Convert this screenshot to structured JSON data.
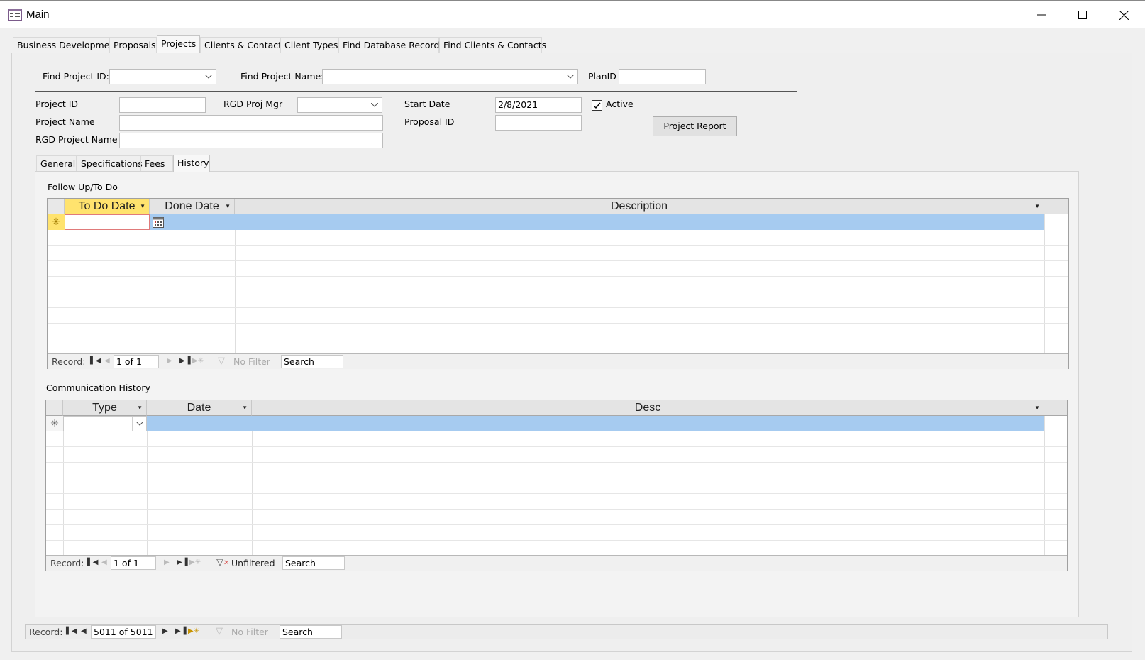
{
  "window": {
    "title": "Main",
    "icon": "form-window-icon"
  },
  "main_tabs": [
    {
      "label": "Business Development"
    },
    {
      "label": "Proposals"
    },
    {
      "label": "Projects"
    },
    {
      "label": "Clients & Contacts"
    },
    {
      "label": "Client Types"
    },
    {
      "label": "Find Database Records"
    },
    {
      "label": "Find Clients & Contacts"
    }
  ],
  "active_main_tab": "Projects",
  "find": {
    "project_id_label": "Find Project ID:",
    "project_name_label": "Find Project Name:",
    "planid_label": "PlanID",
    "project_id_value": "",
    "project_name_value": "",
    "planid_value": ""
  },
  "form": {
    "project_id_label": "Project ID",
    "project_id_value": "",
    "rgd_proj_mgr_label": "RGD Proj Mgr",
    "rgd_proj_mgr_value": "",
    "start_date_label": "Start Date",
    "start_date_value": "2/8/2021",
    "active_label": "Active",
    "active_checked": true,
    "project_name_label": "Project Name",
    "project_name_value": "",
    "proposal_id_label": "Proposal ID",
    "proposal_id_value": "",
    "rgd_project_name_label": "RGD Project Name",
    "rgd_project_name_value": "",
    "project_report_button": "Project Report"
  },
  "sub_tabs": [
    {
      "label": "General"
    },
    {
      "label": "Specifications"
    },
    {
      "label": "Fees"
    },
    {
      "label": "History"
    }
  ],
  "active_sub_tab": "History",
  "followup": {
    "title": "Follow Up/To Do",
    "columns": [
      "To Do Date",
      "Done Date",
      "Description"
    ],
    "nav": {
      "record_label": "Record:",
      "position": "1 of 1",
      "filter": "No Filter",
      "search": "Search"
    }
  },
  "comm": {
    "title": "Communication History",
    "columns": [
      "Type",
      "Date",
      "Desc"
    ],
    "nav": {
      "record_label": "Record:",
      "position": "1 of 1",
      "filter": "Unfiltered",
      "search": "Search"
    }
  },
  "main_nav": {
    "record_label": "Record:",
    "position": "5011 of 5011",
    "filter": "No Filter",
    "search": "Search"
  },
  "colors": {
    "selected_row": "#a6cbf0",
    "active_header": "#ffe36e",
    "accent_red": "#d9534f"
  }
}
